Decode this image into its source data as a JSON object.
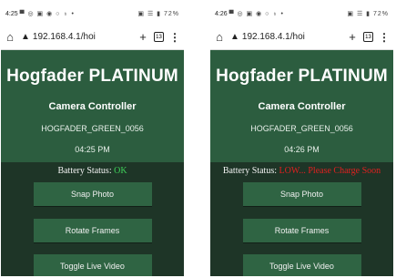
{
  "screens": [
    {
      "status": {
        "time": "4:25",
        "indicators": "▀ ◎ ▣ ◉ ○ ♁ •",
        "right": "▣ ☰ ▮ 72%"
      },
      "browser": {
        "url": "192.168.4.1/hoi",
        "tab_count": "13"
      },
      "app": {
        "title": "Hogfader PLATINUM",
        "subtitle": "Camera Controller",
        "device_id": "HOGFADER_GREEN_0056",
        "time": "04:25 PM",
        "battery_label": "Battery Status: ",
        "battery_value": "OK",
        "buttons": [
          "Snap Photo",
          "Rotate Frames",
          "Toggle Live Video"
        ]
      }
    },
    {
      "status": {
        "time": "4:26",
        "indicators": "▀ ◎ ▣ ◉ ○ ♁ •",
        "right": "▣ ☰ ▮ 72%"
      },
      "browser": {
        "url": "192.168.4.1/hoi",
        "tab_count": "13"
      },
      "app": {
        "title": "Hogfader PLATINUM",
        "subtitle": "Camera Controller",
        "device_id": "HOGFADER_GREEN_0056",
        "time": "04:26 PM",
        "battery_label": "Battery Status: ",
        "battery_value": "LOW... Please Charge Soon",
        "buttons": [
          "Snap Photo",
          "Rotate Frames",
          "Toggle Live Video"
        ]
      }
    }
  ],
  "colors": {
    "ok": "#3fd05a",
    "low": "#e02020",
    "header": "#2c5d3f",
    "background": "#1e3527",
    "button": "#2f6443"
  }
}
